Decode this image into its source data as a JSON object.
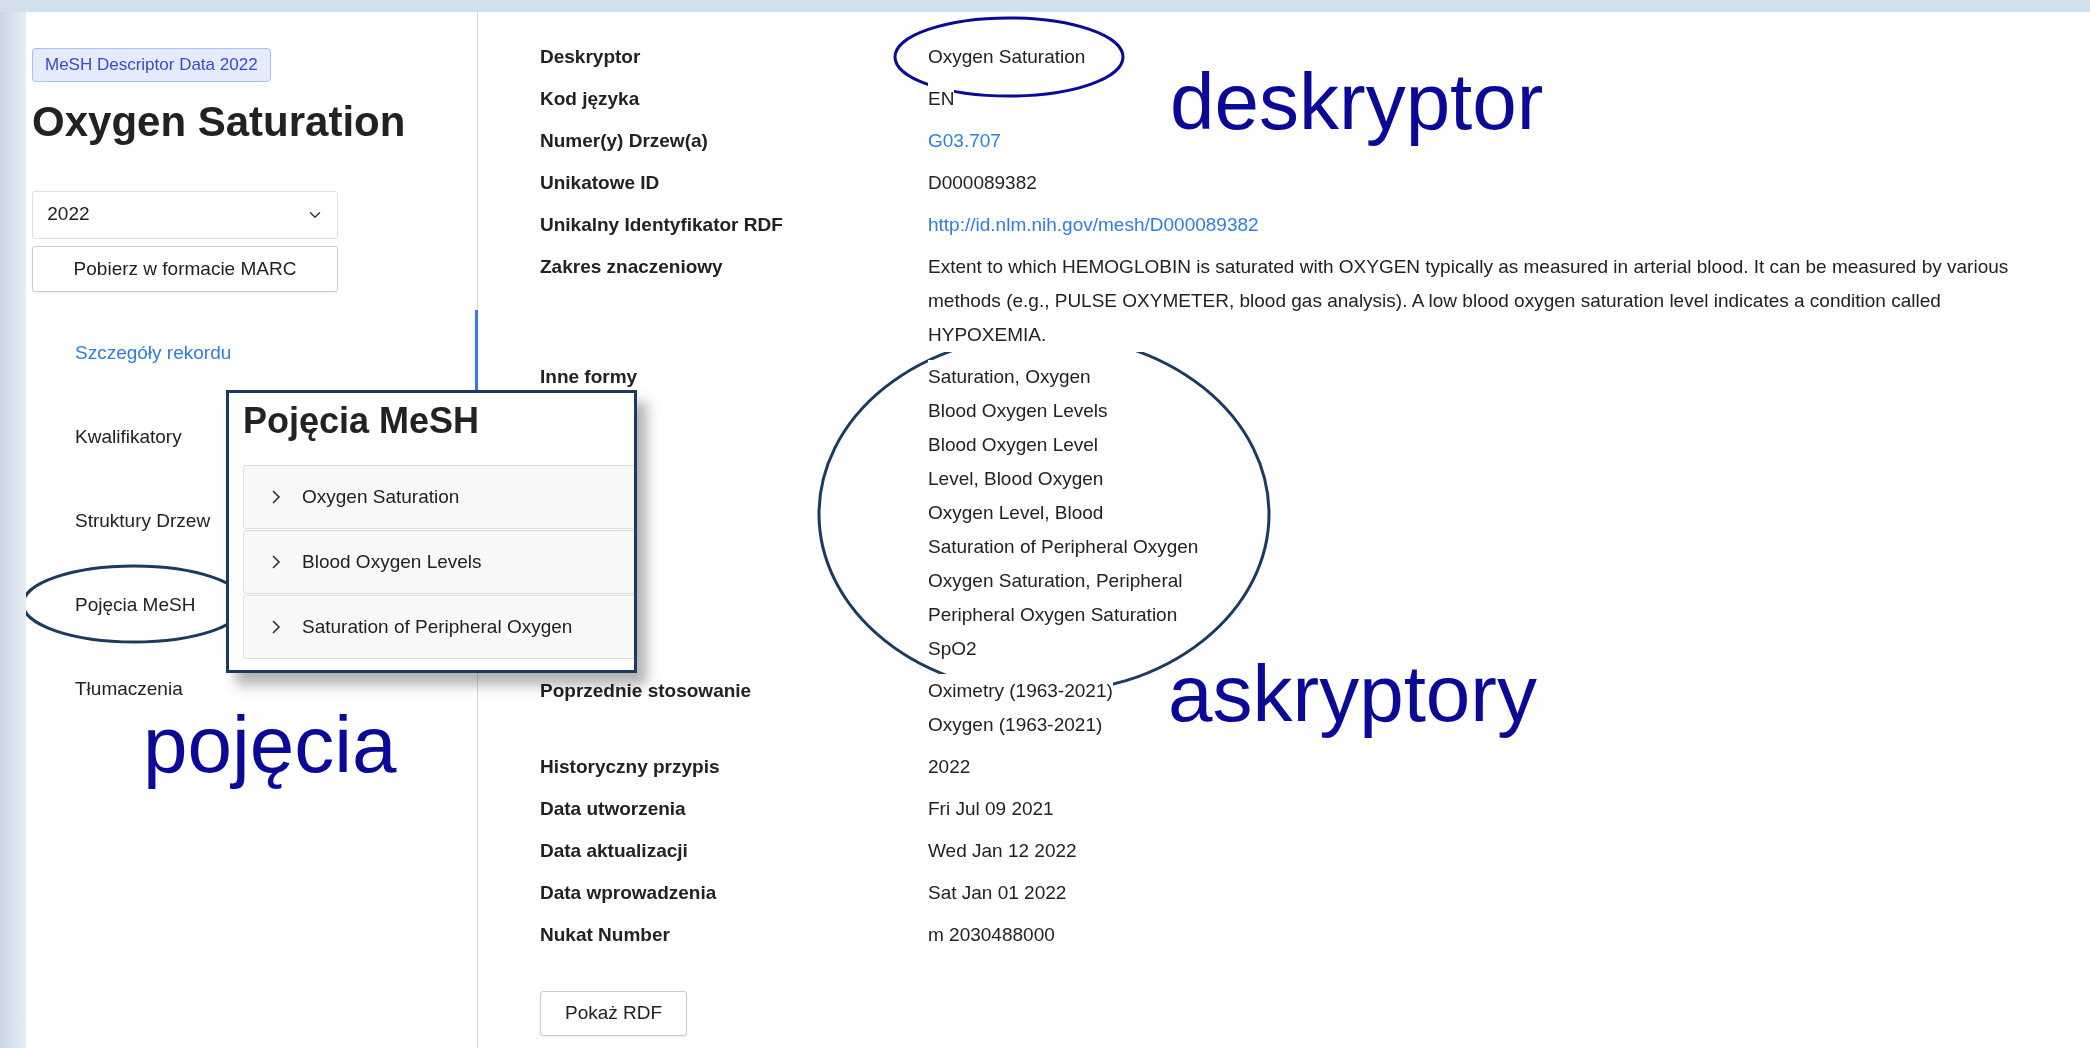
{
  "sidebar": {
    "badge": "MeSH Descriptor Data 2022",
    "title": "Oxygen Saturation",
    "year_select": {
      "value": "2022"
    },
    "marc_button": "Pobierz w formacie MARC",
    "nav": [
      {
        "label": "Szczegóły rekordu",
        "selected": true
      },
      {
        "label": "Kwalifikatory",
        "selected": false
      },
      {
        "label": "Struktury Drzew",
        "selected": false
      },
      {
        "label": "Pojęcia MeSH",
        "selected": false
      },
      {
        "label": "Tłumaczenia",
        "selected": false
      }
    ]
  },
  "record": [
    {
      "label": "Deskryptor",
      "kind": "text",
      "values": [
        "Oxygen Saturation"
      ]
    },
    {
      "label": "Kod języka",
      "kind": "text",
      "values": [
        "EN"
      ]
    },
    {
      "label": "Numer(y) Drzew(a)",
      "kind": "link",
      "values": [
        "G03.707"
      ]
    },
    {
      "label": "Unikatowe ID",
      "kind": "text",
      "values": [
        "D000089382"
      ]
    },
    {
      "label": "Unikalny Identyfikator RDF",
      "kind": "link",
      "values": [
        "http://id.nlm.nih.gov/mesh/D000089382"
      ]
    },
    {
      "label": "Zakres znaczeniowy",
      "kind": "text",
      "values": [
        "Extent to which HEMOGLOBIN is saturated with OXYGEN typically as measured in arterial blood. It can be measured by various methods (e.g., PULSE OXYMETER, blood gas analysis). A low blood oxygen saturation level indicates a condition called HYPOXEMIA."
      ]
    },
    {
      "label": "Inne formy",
      "kind": "text",
      "values": [
        "Saturation, Oxygen",
        "Blood Oxygen Levels",
        "Blood Oxygen Level",
        "Level, Blood Oxygen",
        "Oxygen Level, Blood",
        "Saturation of Peripheral Oxygen",
        "Oxygen Saturation, Peripheral",
        "Peripheral Oxygen Saturation",
        "SpO2"
      ]
    },
    {
      "label": "Poprzednie stosowanie",
      "kind": "text",
      "values": [
        "Oximetry (1963-2021)",
        "Oxygen (1963-2021)"
      ]
    },
    {
      "label": "Historyczny przypis",
      "kind": "text",
      "values": [
        "2022"
      ]
    },
    {
      "label": "Data utworzenia",
      "kind": "text",
      "values": [
        "Fri Jul 09 2021"
      ]
    },
    {
      "label": "Data aktualizacji",
      "kind": "text",
      "values": [
        "Wed Jan 12 2022"
      ]
    },
    {
      "label": "Data wprowadzenia",
      "kind": "text",
      "values": [
        "Sat Jan 01 2022"
      ]
    },
    {
      "label": "Nukat Number",
      "kind": "text",
      "values": [
        "m 2030488000"
      ]
    }
  ],
  "rdf_button": "Pokaż RDF",
  "callout": {
    "title": "Pojęcia MeSH",
    "items": [
      {
        "label": "Oxygen Saturation",
        "expanded": false
      },
      {
        "label": "Blood Oxygen Levels",
        "expanded": false
      },
      {
        "label": "Saturation of Peripheral Oxygen",
        "expanded": false
      }
    ]
  },
  "annotations": [
    "deskryptor",
    "askryptory",
    "pojęcia"
  ]
}
